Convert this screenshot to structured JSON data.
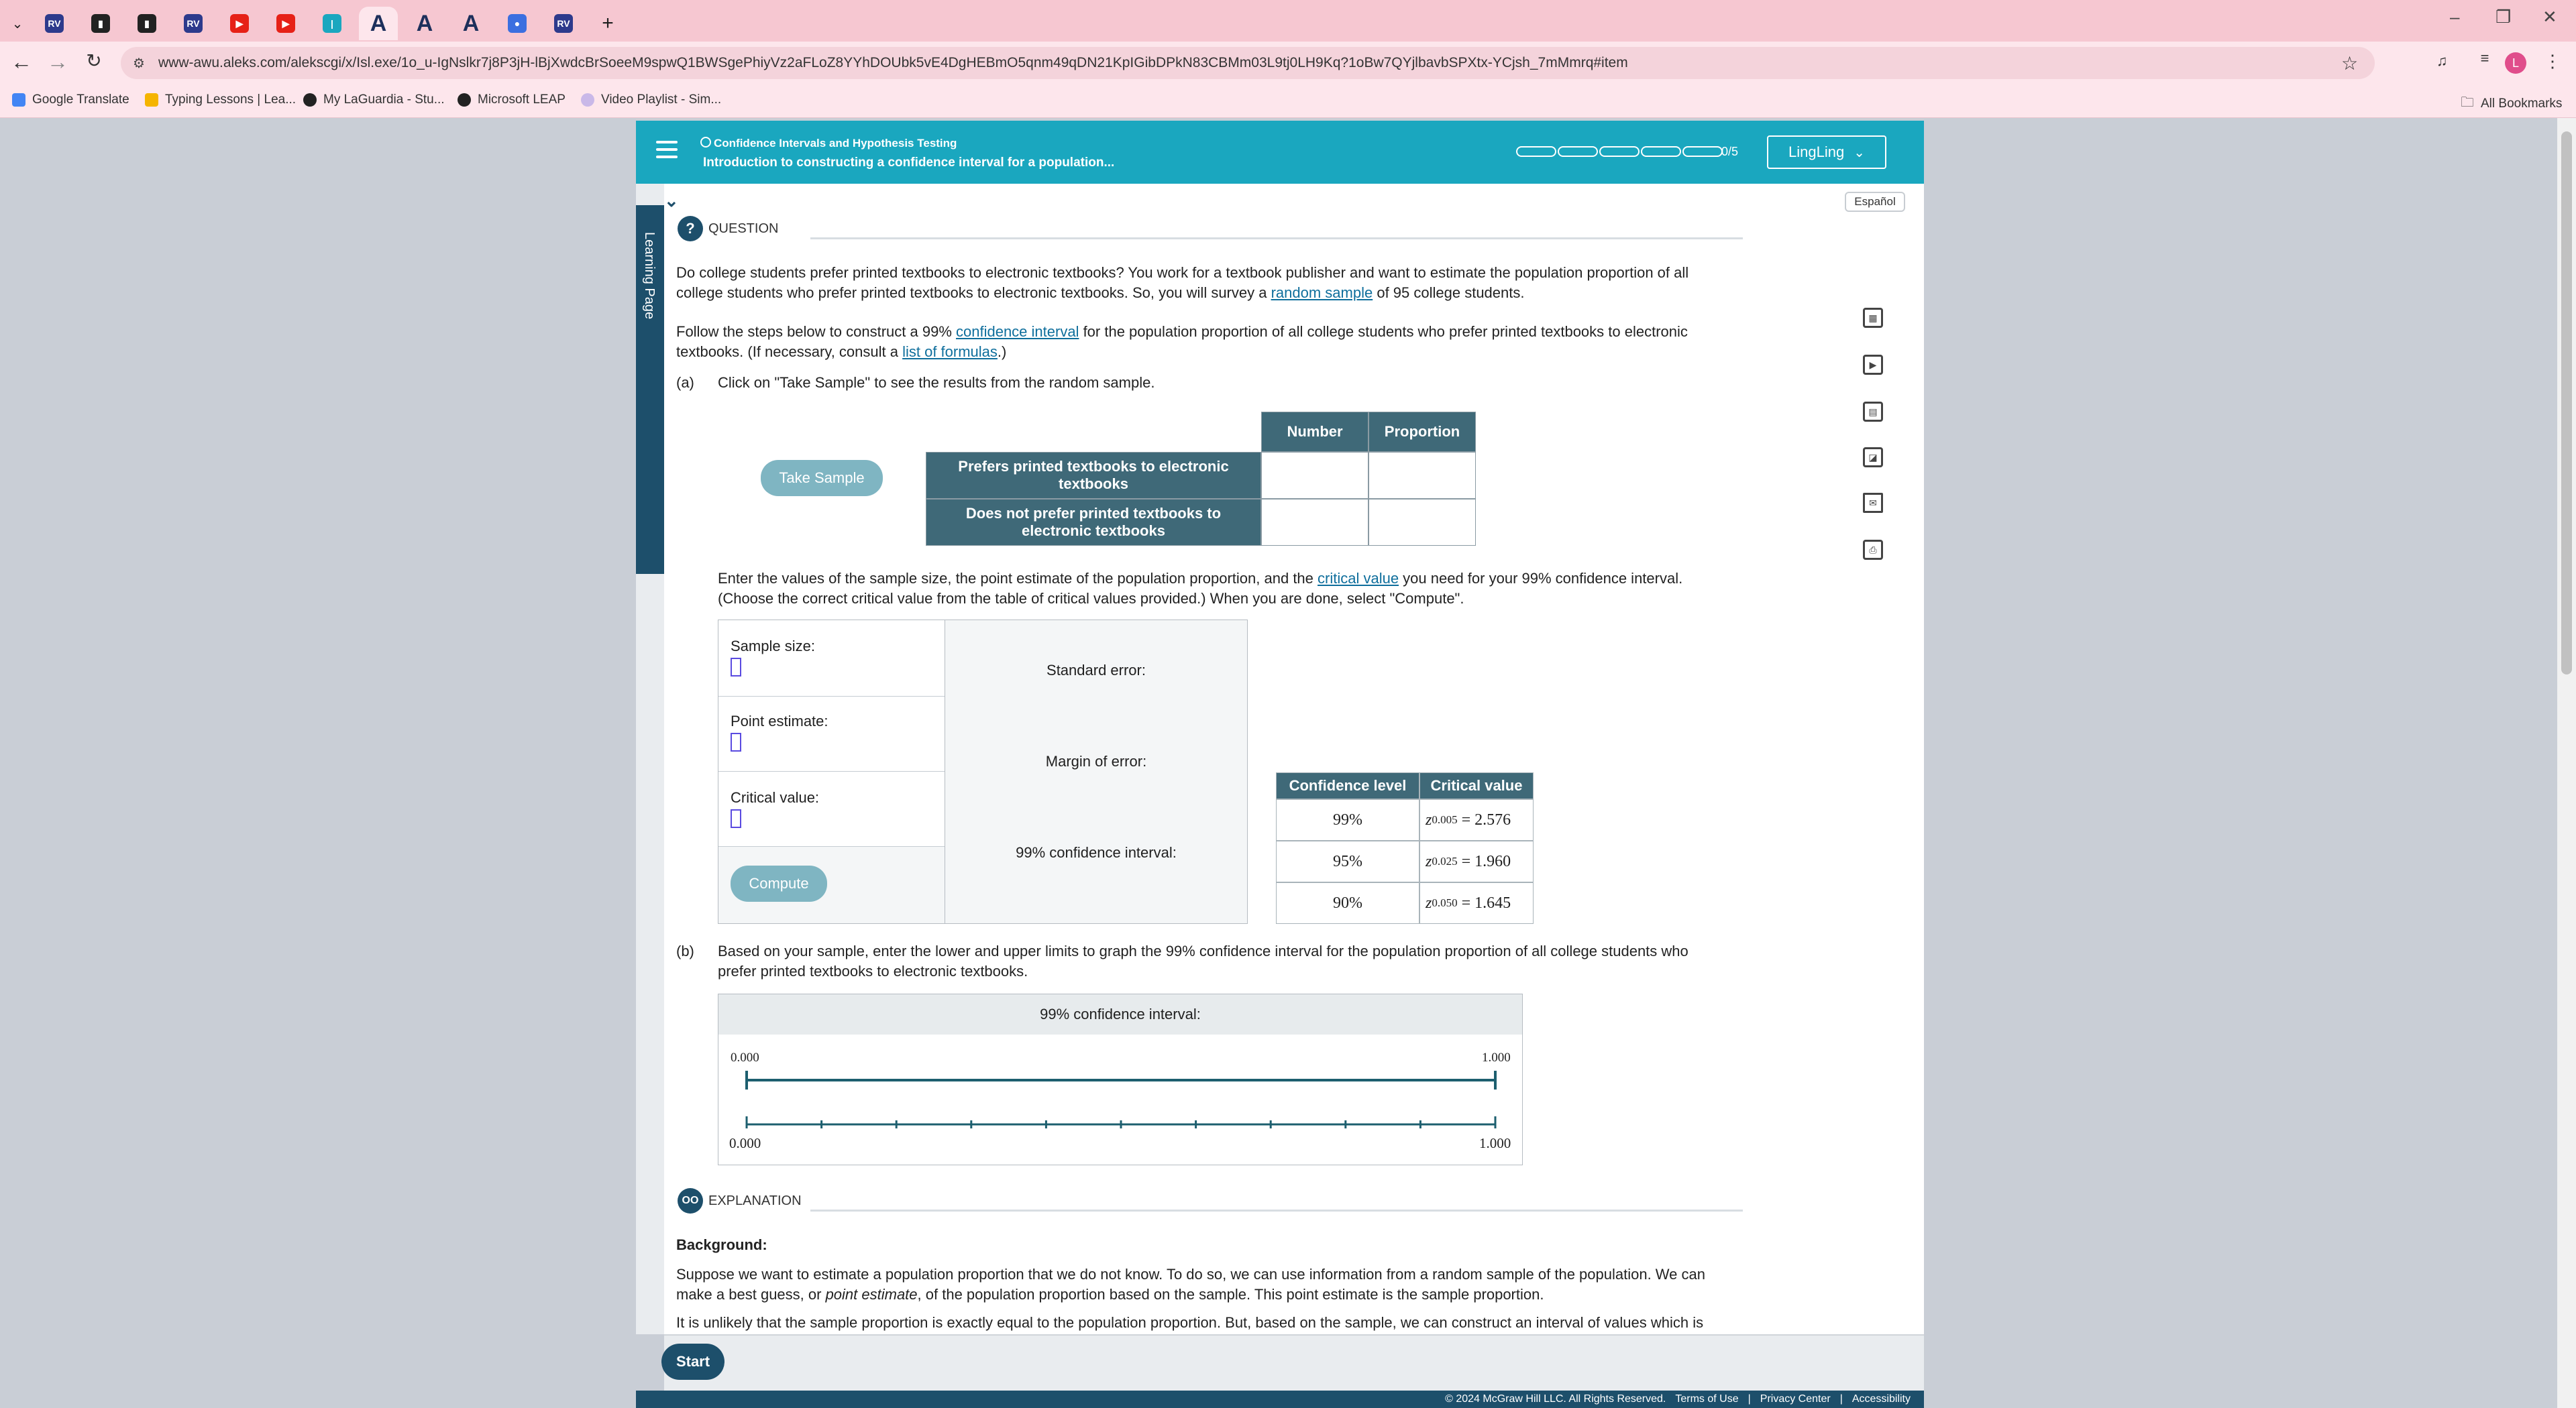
{
  "browser": {
    "tabs": [
      {
        "icon": "aleks-favicon",
        "color": "#2d3a8c",
        "glyph": "RV"
      },
      {
        "icon": "chart-favicon",
        "color": "#222222",
        "glyph": "▮"
      },
      {
        "icon": "chart-favicon",
        "color": "#222222",
        "glyph": "▮"
      },
      {
        "icon": "aleks-favicon",
        "color": "#2d3a8c",
        "glyph": "RV"
      },
      {
        "icon": "youtube-favicon",
        "color": "#e62117",
        "glyph": "▶"
      },
      {
        "icon": "youtube-favicon",
        "color": "#e62117",
        "glyph": "▶"
      },
      {
        "icon": "bars-favicon",
        "color": "#1aa7bf",
        "glyph": "|"
      },
      {
        "icon": "a-favicon",
        "color": "#1d2f5b",
        "glyph": "A"
      },
      {
        "icon": "a-favicon",
        "color": "#1d2f5b",
        "glyph": "A"
      },
      {
        "icon": "a-favicon",
        "color": "#1d2f5b",
        "glyph": "A"
      },
      {
        "icon": "blue-circle-favicon",
        "color": "#3b6fe0",
        "glyph": "●"
      },
      {
        "icon": "aleks-favicon",
        "color": "#2d3a8c",
        "glyph": "RV"
      }
    ],
    "new_tab": "+",
    "url": "www-awu.aleks.com/alekscgi/x/Isl.exe/1o_u-IgNslkr7j8P3jH-lBjXwdcBrSoeeM9spwQ1BWSgePhiyVz2aFLoZ8YYhDOUbk5vE4DgHEBmO5qnm49qDN21KpIGibDPkN83CBMm03L9tj0LH9Kq?1oBw7QYjlbavbSPXtx-YCjsh_7mMmrq#item",
    "bookmarks": [
      "Google Translate",
      "Typing Lessons | Lea...",
      "My LaGuardia - Stu...",
      "Microsoft LEAP",
      "Video Playlist - Sim..."
    ],
    "all_bookmarks": "All Bookmarks",
    "profile_initial": "L"
  },
  "header": {
    "topic": "Confidence Intervals and Hypothesis Testing",
    "subtitle": "Introduction to constructing a confidence interval for a population...",
    "progress_text": "0/5",
    "progress_fraction": 0,
    "user": "LingLing"
  },
  "sidebar_label": "Learning Page",
  "espanol": "Español",
  "question": {
    "head": "QUESTION",
    "p1a": "Do college students prefer printed textbooks to electronic textbooks? You work for a textbook publisher and want to estimate the population proportion of all",
    "p1b_pre": "college students who prefer printed textbooks to electronic textbooks. So, you will survey a ",
    "p1b_link": "random sample",
    "p1b_post": " of 95 college students.",
    "p2a_pre": "Follow the steps below to construct a 99% ",
    "p2a_link": "confidence interval",
    "p2a_post": " for the population proportion of all college students who prefer printed textbooks to electronic",
    "p2b_pre": "textbooks. (If necessary, consult a ",
    "p2b_link": "list of formulas",
    "p2b_post": ".)",
    "part_a": "(a)",
    "part_a_text": "Click on \"Take Sample\" to see the results from the random sample."
  },
  "sample": {
    "button": "Take Sample",
    "col_number": "Number",
    "col_proportion": "Proportion",
    "row1": "Prefers printed textbooks to electronic textbooks",
    "row2": "Does not prefer printed textbooks to electronic textbooks"
  },
  "instructions": {
    "l1_pre": "Enter the values of the sample size, the point estimate of the population proportion, and the ",
    "l1_link": "critical value",
    "l1_post": " you need for your 99% confidence interval.",
    "l2": "(Choose the correct critical value from the table of critical values provided.) When you are done, select \"Compute\"."
  },
  "form": {
    "sample_size": "Sample size:",
    "point_estimate": "Point estimate:",
    "critical_value": "Critical value:",
    "compute": "Compute",
    "standard_error": "Standard error:",
    "margin_of_error": "Margin of error:",
    "ci_label": "99% confidence interval:"
  },
  "critical_table": {
    "h1": "Confidence level",
    "h2": "Critical value",
    "rows": [
      {
        "level": "99%",
        "z": "z",
        "sub": "0.005",
        "val": "= 2.576"
      },
      {
        "level": "95%",
        "z": "z",
        "sub": "0.025",
        "val": "= 1.960"
      },
      {
        "level": "90%",
        "z": "z",
        "sub": "0.050",
        "val": "= 1.645"
      }
    ]
  },
  "part_b": {
    "label": "(b)",
    "l1": "Based on your sample, enter the lower and upper limits to graph the 99% confidence interval for the population proportion of all college students who",
    "l2": "prefer printed textbooks to electronic textbooks."
  },
  "ci_graph": {
    "head": "99% confidence interval:",
    "top_left": "0.000",
    "top_right": "1.000",
    "bottom_left": "0.000",
    "bottom_right": "1.000"
  },
  "explanation": {
    "head": "EXPLANATION",
    "background": "Background:",
    "p1": "Suppose we want to estimate a population proportion that we do not know. To do so, we can use information from a random sample of the population. We can",
    "p2_pre": "make a best guess, or ",
    "p2_em": "point estimate",
    "p2_post": ", of the population proportion based on the sample. This point estimate is the sample proportion.",
    "p3": "It is unlikely that the sample proportion is exactly equal to the population proportion. But, based on the sample, we can construct an interval of values which is"
  },
  "footer": {
    "start": "Start",
    "copyright": "© 2024 McGraw Hill LLC. All Rights Reserved.",
    "terms": "Terms of Use",
    "privacy": "Privacy Center",
    "accessibility": "Accessibility"
  },
  "colors": {
    "brand_teal": "#1aa7bf",
    "dark_teal": "#1d4f6b",
    "table_header": "#3f6978",
    "tab_bar": "#f6c7d1"
  }
}
